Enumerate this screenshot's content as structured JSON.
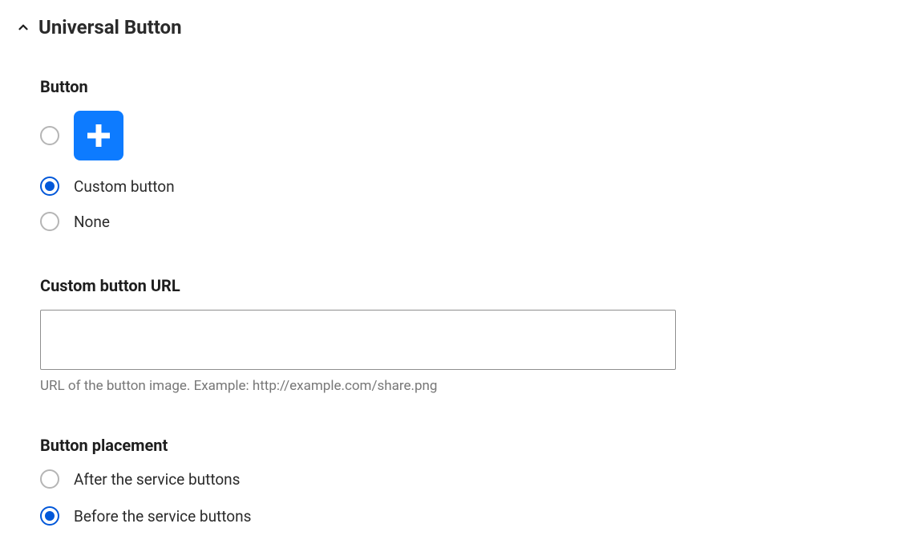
{
  "section": {
    "title": "Universal Button"
  },
  "button_field": {
    "label": "Button",
    "options": {
      "plus_icon": "plus",
      "custom": "Custom button",
      "none": "None"
    },
    "selected": "custom"
  },
  "custom_url": {
    "label": "Custom button URL",
    "value": "",
    "help": "URL of the button image. Example: http://example.com/share.png"
  },
  "placement": {
    "label": "Button placement",
    "options": {
      "after": "After the service buttons",
      "before": "Before the service buttons"
    },
    "selected": "before"
  }
}
